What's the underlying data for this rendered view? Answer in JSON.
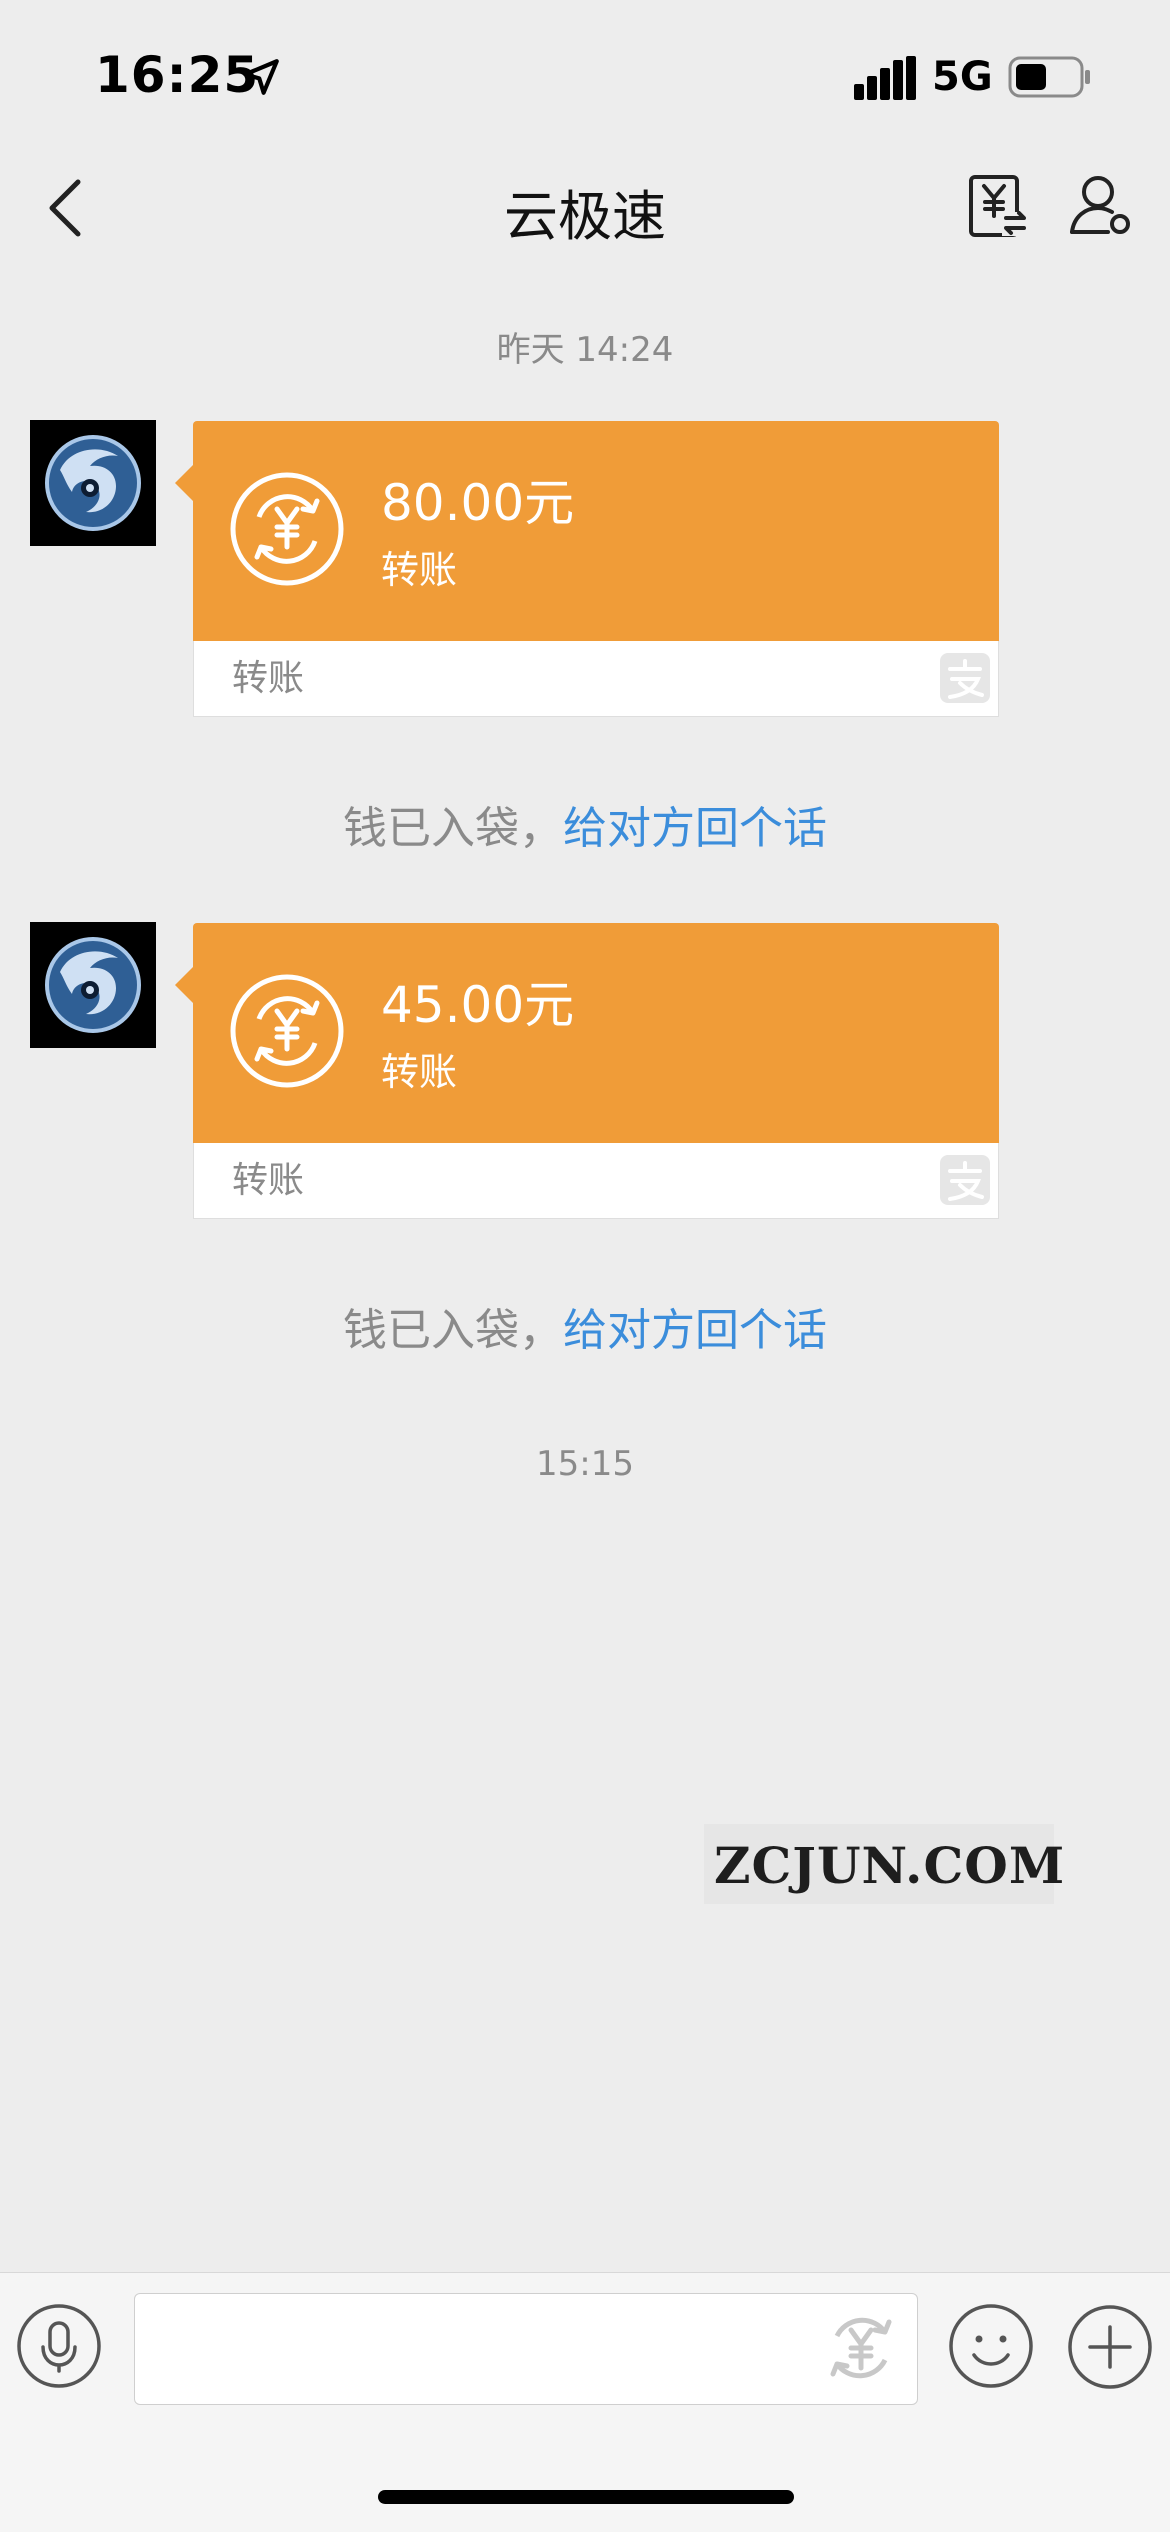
{
  "status_bar": {
    "time": "16:25",
    "network": "5G"
  },
  "header": {
    "title": "云极速"
  },
  "chat": {
    "timestamp_1": "昨天 14:24",
    "messages": [
      {
        "amount": "80.00元",
        "subtitle": "转账",
        "footer": "转账"
      },
      {
        "amount": "45.00元",
        "subtitle": "转账",
        "footer": "转账"
      }
    ],
    "notice_text": "钱已入袋，",
    "notice_link": "给对方回个话",
    "timestamp_2": "15:15"
  },
  "watermark": {
    "text": "ZCJUN.COM"
  },
  "colors": {
    "card_orange": "#f09c38",
    "link_blue": "#3b8ddb",
    "background": "#ededed"
  },
  "icons": [
    "location-arrow-icon",
    "signal-icon",
    "battery-icon",
    "back-chevron-icon",
    "transfer-icon",
    "profile-settings-icon",
    "coin-yen-icon",
    "alipay-icon",
    "voice-icon",
    "red-packet-icon",
    "emoji-icon",
    "plus-icon"
  ]
}
